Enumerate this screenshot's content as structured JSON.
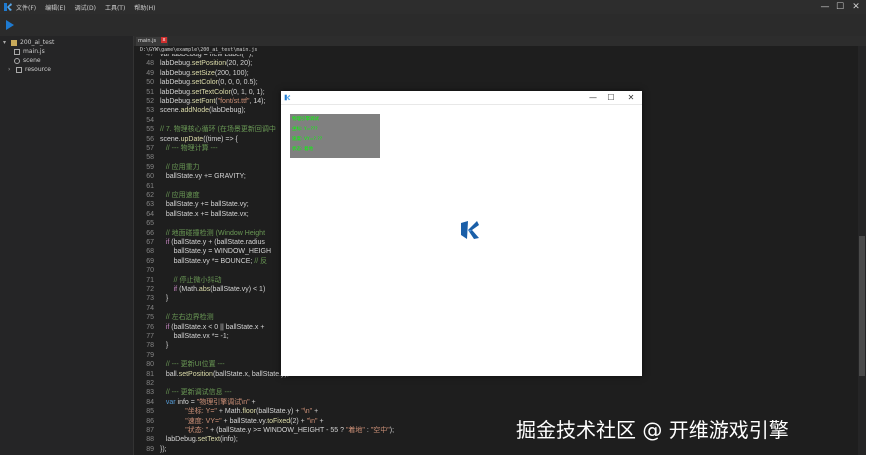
{
  "titlebar": {
    "menu": [
      "文件(F)",
      "编辑(E)",
      "调试(D)",
      "工具(T)",
      "帮助(H)"
    ],
    "min_label": "—",
    "max_label": "☐",
    "close_label": "✕"
  },
  "sidebar": {
    "project": "200_ai_test",
    "items": [
      "main.js",
      "scene",
      "resource"
    ]
  },
  "tab": {
    "label": "main.js",
    "close": "x"
  },
  "path": "D:\\GYW\\game\\example\\200_ai_test\\main.js",
  "code_lines": [
    {
      "n": "47",
      "segs": [
        {
          "t": "var labDebug = new Label(\"\");",
          "c": "#d4d4d4"
        }
      ]
    },
    {
      "n": "48",
      "segs": [
        {
          "t": "labDebug.",
          "c": "#d4d4d4"
        },
        {
          "t": "setPosition",
          "c": "#dcdcaa"
        },
        {
          "t": "(20, 20);",
          "c": "#d4d4d4"
        }
      ]
    },
    {
      "n": "49",
      "segs": [
        {
          "t": "labDebug.",
          "c": "#d4d4d4"
        },
        {
          "t": "setSize",
          "c": "#dcdcaa"
        },
        {
          "t": "(200, 100);",
          "c": "#d4d4d4"
        }
      ]
    },
    {
      "n": "50",
      "segs": [
        {
          "t": "labDebug.",
          "c": "#d4d4d4"
        },
        {
          "t": "setColor",
          "c": "#dcdcaa"
        },
        {
          "t": "(0, 0, 0, 0.5);",
          "c": "#d4d4d4"
        }
      ]
    },
    {
      "n": "51",
      "segs": [
        {
          "t": "labDebug.",
          "c": "#d4d4d4"
        },
        {
          "t": "setTextColor",
          "c": "#dcdcaa"
        },
        {
          "t": "(0, 1, 0, 1);",
          "c": "#d4d4d4"
        }
      ]
    },
    {
      "n": "52",
      "segs": [
        {
          "t": "labDebug.",
          "c": "#d4d4d4"
        },
        {
          "t": "setFont",
          "c": "#dcdcaa"
        },
        {
          "t": "(",
          "c": "#d4d4d4"
        },
        {
          "t": "\"font/st.ttf\"",
          "c": "#ce9178"
        },
        {
          "t": ", 14);",
          "c": "#d4d4d4"
        }
      ]
    },
    {
      "n": "53",
      "segs": [
        {
          "t": "scene.",
          "c": "#d4d4d4"
        },
        {
          "t": "addNode",
          "c": "#dcdcaa"
        },
        {
          "t": "(labDebug);",
          "c": "#d4d4d4"
        }
      ]
    },
    {
      "n": "54",
      "segs": []
    },
    {
      "n": "55",
      "segs": [
        {
          "t": "// 7. 物理核心循环 (在场景更新回调中",
          "c": "#6a9955"
        }
      ]
    },
    {
      "n": "56",
      "segs": [
        {
          "t": "scene.",
          "c": "#d4d4d4"
        },
        {
          "t": "upDate",
          "c": "#dcdcaa"
        },
        {
          "t": "((time) => {",
          "c": "#d4d4d4"
        }
      ]
    },
    {
      "n": "57",
      "segs": [
        {
          "t": "   // --- 物理计算 ---",
          "c": "#6a9955"
        }
      ]
    },
    {
      "n": "58",
      "segs": []
    },
    {
      "n": "59",
      "segs": [
        {
          "t": "   // 应用重力",
          "c": "#6a9955"
        }
      ]
    },
    {
      "n": "60",
      "segs": [
        {
          "t": "   ballState.vy += GRAVITY;",
          "c": "#d4d4d4"
        }
      ]
    },
    {
      "n": "61",
      "segs": []
    },
    {
      "n": "62",
      "segs": [
        {
          "t": "   // 应用速度",
          "c": "#6a9955"
        }
      ]
    },
    {
      "n": "63",
      "segs": [
        {
          "t": "   ballState.y += ballState.vy;",
          "c": "#d4d4d4"
        }
      ]
    },
    {
      "n": "64",
      "segs": [
        {
          "t": "   ballState.x += ballState.vx;",
          "c": "#d4d4d4"
        }
      ]
    },
    {
      "n": "65",
      "segs": []
    },
    {
      "n": "66",
      "segs": [
        {
          "t": "   // 地面碰撞检测 (Window Height",
          "c": "#6a9955"
        }
      ]
    },
    {
      "n": "67",
      "segs": [
        {
          "t": "   ",
          "c": "#d4d4d4"
        },
        {
          "t": "if",
          "c": "#c586c0"
        },
        {
          "t": " (ballState.y + (ballState.radius",
          "c": "#d4d4d4"
        }
      ]
    },
    {
      "n": "68",
      "segs": [
        {
          "t": "       ballState.y = WINDOW_HEIGH",
          "c": "#d4d4d4"
        }
      ]
    },
    {
      "n": "69",
      "segs": [
        {
          "t": "       ballState.vy *= BOUNCE; ",
          "c": "#d4d4d4"
        },
        {
          "t": "// 反",
          "c": "#6a9955"
        }
      ]
    },
    {
      "n": "70",
      "segs": []
    },
    {
      "n": "71",
      "segs": [
        {
          "t": "       // 停止微小抖动",
          "c": "#6a9955"
        }
      ]
    },
    {
      "n": "72",
      "segs": [
        {
          "t": "       ",
          "c": "#d4d4d4"
        },
        {
          "t": "if",
          "c": "#c586c0"
        },
        {
          "t": " (Math.",
          "c": "#d4d4d4"
        },
        {
          "t": "abs",
          "c": "#dcdcaa"
        },
        {
          "t": "(ballState.vy) < 1)",
          "c": "#d4d4d4"
        }
      ]
    },
    {
      "n": "73",
      "segs": [
        {
          "t": "   }",
          "c": "#d4d4d4"
        }
      ]
    },
    {
      "n": "74",
      "segs": []
    },
    {
      "n": "75",
      "segs": [
        {
          "t": "   // 左右边界检测",
          "c": "#6a9955"
        }
      ]
    },
    {
      "n": "76",
      "segs": [
        {
          "t": "   ",
          "c": "#d4d4d4"
        },
        {
          "t": "if",
          "c": "#c586c0"
        },
        {
          "t": " (ballState.x < 0 || ballState.x +",
          "c": "#d4d4d4"
        }
      ]
    },
    {
      "n": "77",
      "segs": [
        {
          "t": "       ballState.vx *= -1;",
          "c": "#d4d4d4"
        }
      ]
    },
    {
      "n": "78",
      "segs": [
        {
          "t": "   }",
          "c": "#d4d4d4"
        }
      ]
    },
    {
      "n": "79",
      "segs": []
    },
    {
      "n": "80",
      "segs": [
        {
          "t": "   // --- 更新UI位置 ---",
          "c": "#6a9955"
        }
      ]
    },
    {
      "n": "81",
      "segs": [
        {
          "t": "   ball.",
          "c": "#d4d4d4"
        },
        {
          "t": "setPosition",
          "c": "#dcdcaa"
        },
        {
          "t": "(ballState.x, ballState.y);",
          "c": "#d4d4d4"
        }
      ]
    },
    {
      "n": "82",
      "segs": []
    },
    {
      "n": "83",
      "segs": [
        {
          "t": "   // --- 更新调试信息 ---",
          "c": "#6a9955"
        }
      ]
    },
    {
      "n": "84",
      "segs": [
        {
          "t": "   ",
          "c": "#d4d4d4"
        },
        {
          "t": "var",
          "c": "#569cd6"
        },
        {
          "t": " info = ",
          "c": "#d4d4d4"
        },
        {
          "t": "\"物理引擎调试\\n\"",
          "c": "#ce9178"
        },
        {
          "t": " +",
          "c": "#d4d4d4"
        }
      ]
    },
    {
      "n": "85",
      "segs": [
        {
          "t": "             ",
          "c": "#d4d4d4"
        },
        {
          "t": "\"坐标: Y=\"",
          "c": "#ce9178"
        },
        {
          "t": " + Math.",
          "c": "#d4d4d4"
        },
        {
          "t": "floor",
          "c": "#dcdcaa"
        },
        {
          "t": "(ballState.y) + ",
          "c": "#d4d4d4"
        },
        {
          "t": "\"\\n\"",
          "c": "#ce9178"
        },
        {
          "t": " +",
          "c": "#d4d4d4"
        }
      ]
    },
    {
      "n": "86",
      "segs": [
        {
          "t": "             ",
          "c": "#d4d4d4"
        },
        {
          "t": "\"速度: VY=\"",
          "c": "#ce9178"
        },
        {
          "t": " + ballState.vy.",
          "c": "#d4d4d4"
        },
        {
          "t": "toFixed",
          "c": "#dcdcaa"
        },
        {
          "t": "(2) + ",
          "c": "#d4d4d4"
        },
        {
          "t": "\"\\n\"",
          "c": "#ce9178"
        },
        {
          "t": " +",
          "c": "#d4d4d4"
        }
      ]
    },
    {
      "n": "87",
      "segs": [
        {
          "t": "             ",
          "c": "#d4d4d4"
        },
        {
          "t": "\"状态: \"",
          "c": "#ce9178"
        },
        {
          "t": " + (ballState.y >= WINDOW_HEIGHT - 55 ? ",
          "c": "#d4d4d4"
        },
        {
          "t": "\"着地\"",
          "c": "#ce9178"
        },
        {
          "t": " : ",
          "c": "#d4d4d4"
        },
        {
          "t": "\"空中\"",
          "c": "#ce9178"
        },
        {
          "t": ");",
          "c": "#d4d4d4"
        }
      ]
    },
    {
      "n": "88",
      "segs": [
        {
          "t": "   labDebug.",
          "c": "#d4d4d4"
        },
        {
          "t": "setText",
          "c": "#dcdcaa"
        },
        {
          "t": "(info);",
          "c": "#d4d4d4"
        }
      ]
    },
    {
      "n": "89",
      "segs": [
        {
          "t": "});",
          "c": "#d4d4d4"
        }
      ]
    }
  ],
  "game_window": {
    "min_label": "—",
    "max_label": "☐",
    "close_label": "✕",
    "debug_lines": [
      "物理引擎调试",
      "坐标: Y=???",
      "速度: VY=?.??",
      "状态: 着地"
    ]
  },
  "watermark": "掘金技术社区 @ 开维游戏引擎",
  "colors": {
    "accent": "#1e7ad0",
    "logo_blue": "#1a5fa8",
    "debug_text": "#00ff00",
    "tab_close": "#d0302f"
  }
}
